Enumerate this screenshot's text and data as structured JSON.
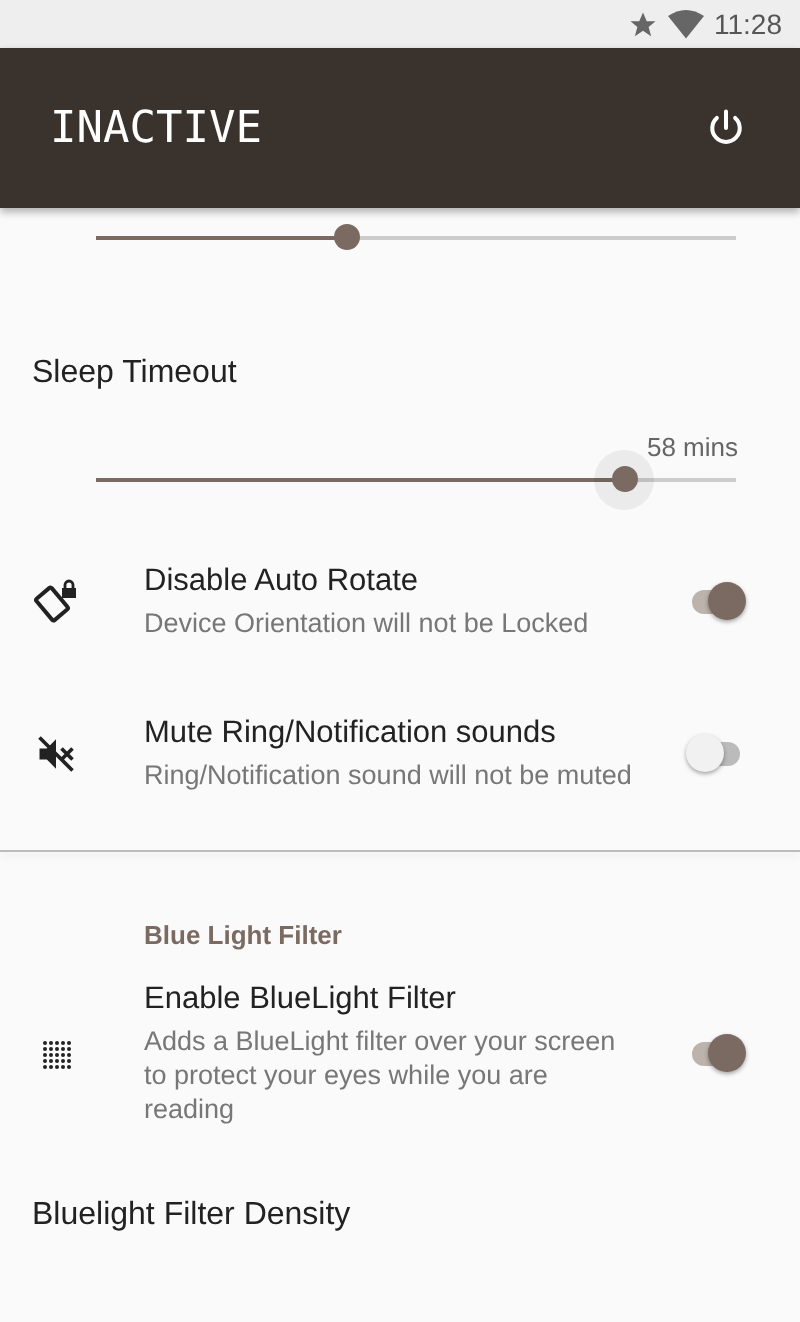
{
  "status_bar": {
    "time": "11:28"
  },
  "app_bar": {
    "title": "INACTIVE"
  },
  "top_slider": {
    "level": 0.39
  },
  "sleep_timeout": {
    "label": "Sleep Timeout",
    "reading": "58 mins",
    "level": 0.825
  },
  "toggles": [
    {
      "title": "Disable Auto Rotate",
      "subtitle": "Device Orientation will not be Locked",
      "on": true
    },
    {
      "title": "Mute Ring/Notification sounds",
      "subtitle": "Ring/Notification sound will not be muted",
      "on": false
    }
  ],
  "blue_light": {
    "header": "Blue Light Filter",
    "items": [
      {
        "title": "Enable BlueLight Filter",
        "subtitle": "Adds a BlueLight filter over your screen to protect your eyes while you are reading",
        "on": true
      }
    ]
  },
  "density": {
    "label": "Bluelight Filter Density"
  }
}
